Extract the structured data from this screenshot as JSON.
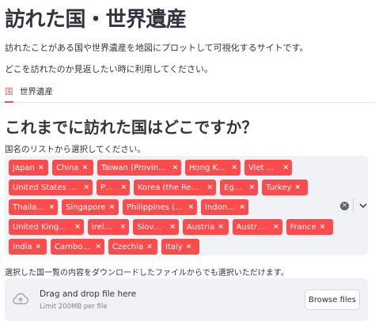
{
  "page": {
    "title": "訪れた国・世界遺産",
    "intro_1": "訪れたことがある国や世界遺産を地図にプロットして可視化するサイトです。",
    "intro_2": "どこを訪れたのか見返したい時に利用してください。"
  },
  "tabs": [
    {
      "label": "国",
      "active": true
    },
    {
      "label": "世界遺産",
      "active": false
    }
  ],
  "section": {
    "heading": "これまでに訪れた国はどこですか？",
    "select_label": "国名のリストから選択してください。"
  },
  "multiselect": {
    "rows": [
      [
        "Japan",
        "China",
        "Taiwan (Provinc...",
        "Hong Kong",
        "Viet Nam"
      ],
      [
        "United States of ...",
        "Peru",
        "Korea (the Repu...",
        "Egypt",
        "Turkey"
      ],
      [
        "Thailand",
        "Singapore",
        "Philippines (the)",
        "Indonesia"
      ],
      [
        "United Kingdom ...",
        "Ireland",
        "Slovakia",
        "Austria",
        "Australia",
        "France"
      ],
      [
        "India",
        "Cambodia",
        "Czechia",
        "Italy"
      ]
    ],
    "remove_symbol": "×",
    "clear_symbol": "×"
  },
  "uploader": {
    "label": "選択した国一覧の内容をダウンロードしたファイルからでも選択いただけます。",
    "main_text": "Drag and drop file here",
    "sub_text": "Limit 200MB per file",
    "button_label": "Browse files"
  },
  "colors": {
    "accent": "#ff4b4b",
    "text": "#31333f",
    "widget_bg": "#f0f2f6",
    "muted": "#808495"
  },
  "icons": {
    "clear": "clear-all-icon",
    "dropdown": "chevron-down-icon",
    "upload": "cloud-upload-icon"
  }
}
